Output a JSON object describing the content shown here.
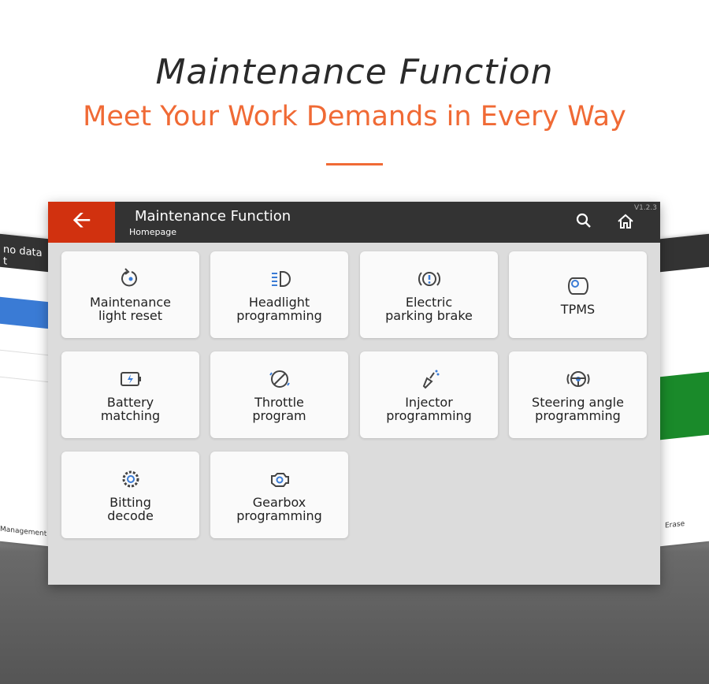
{
  "heading": {
    "title": "Maintenance Function",
    "subtitle": "Meet Your Work Demands in Every Way"
  },
  "left_screen": {
    "title": "no data t",
    "footer": "Management"
  },
  "right_screen": {
    "footer": "Erase"
  },
  "header": {
    "title": "Maintenance Function",
    "breadcrumb": "Homepage",
    "version": "V1.2.3"
  },
  "colors": {
    "accent": "#f06a35",
    "back": "#d1310f",
    "header": "#333333",
    "icon_blue": "#3a7bd5"
  },
  "functions": [
    {
      "label": "Maintenance\nlight reset",
      "icon": "reset-icon"
    },
    {
      "label": "Headlight\nprogramming",
      "icon": "headlight-icon"
    },
    {
      "label": "Electric\nparking brake",
      "icon": "parking-brake-icon"
    },
    {
      "label": "TPMS",
      "icon": "tire-pressure-icon"
    },
    {
      "label": "Battery\nmatching",
      "icon": "battery-icon"
    },
    {
      "label": "Throttle\nprogram",
      "icon": "throttle-icon"
    },
    {
      "label": "Injector\nprogramming",
      "icon": "injector-icon"
    },
    {
      "label": "Steering angle\nprogramming",
      "icon": "steering-wheel-icon"
    },
    {
      "label": "Bitting\ndecode",
      "icon": "key-gear-icon"
    },
    {
      "label": "Gearbox\nprogramming",
      "icon": "gearbox-icon"
    }
  ]
}
